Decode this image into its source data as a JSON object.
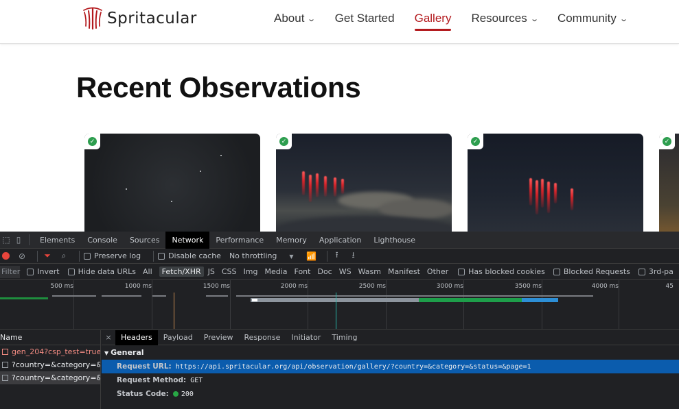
{
  "site": {
    "logo_text": "Spritacular",
    "nav": [
      {
        "label": "About",
        "has_dropdown": true
      },
      {
        "label": "Get Started",
        "has_dropdown": false
      },
      {
        "label": "Gallery",
        "has_dropdown": false,
        "active": true
      },
      {
        "label": "Resources",
        "has_dropdown": true
      },
      {
        "label": "Community",
        "has_dropdown": true
      }
    ],
    "accent_color": "#b3181c"
  },
  "page": {
    "title": "Recent Observations"
  },
  "gallery": {
    "badge_icon": "verified-check-icon",
    "card_count_visible": 4
  },
  "devtools": {
    "tabs": [
      "Elements",
      "Console",
      "Sources",
      "Network",
      "Performance",
      "Memory",
      "Application",
      "Lighthouse"
    ],
    "active_tab": "Network",
    "toolbar": {
      "preserve_log": "Preserve log",
      "disable_cache": "Disable cache",
      "throttling": "No throttling"
    },
    "filter": {
      "placeholder": "Filter",
      "invert": "Invert",
      "hide_data_urls": "Hide data URLs",
      "types": [
        "All",
        "Fetch/XHR",
        "JS",
        "CSS",
        "Img",
        "Media",
        "Font",
        "Doc",
        "WS",
        "Wasm",
        "Manifest",
        "Other"
      ],
      "active_type": "Fetch/XHR",
      "has_blocked_cookies": "Has blocked cookies",
      "blocked_requests": "Blocked Requests",
      "third_party": "3rd-pa"
    },
    "timeline_ticks": [
      "500 ms",
      "1000 ms",
      "1500 ms",
      "2000 ms",
      "2500 ms",
      "3000 ms",
      "3500 ms",
      "4000 ms",
      "45"
    ],
    "requests": {
      "header": "Name",
      "rows": [
        {
          "name": "gen_204?csp_test=true",
          "status": "error"
        },
        {
          "name": "?country=&category=&...",
          "status": "ok"
        },
        {
          "name": "?country=&category=&...",
          "status": "selected"
        }
      ]
    },
    "detail": {
      "close": "×",
      "tabs": [
        "Headers",
        "Payload",
        "Preview",
        "Response",
        "Initiator",
        "Timing"
      ],
      "active_tab": "Headers",
      "section": "General",
      "request_url_label": "Request URL:",
      "request_url": "https://api.spritacular.org/api/observation/gallery/?country=&category=&status=&page=1",
      "request_method_label": "Request Method:",
      "request_method": "GET",
      "status_code_label": "Status Code:",
      "status_code": "200"
    }
  }
}
